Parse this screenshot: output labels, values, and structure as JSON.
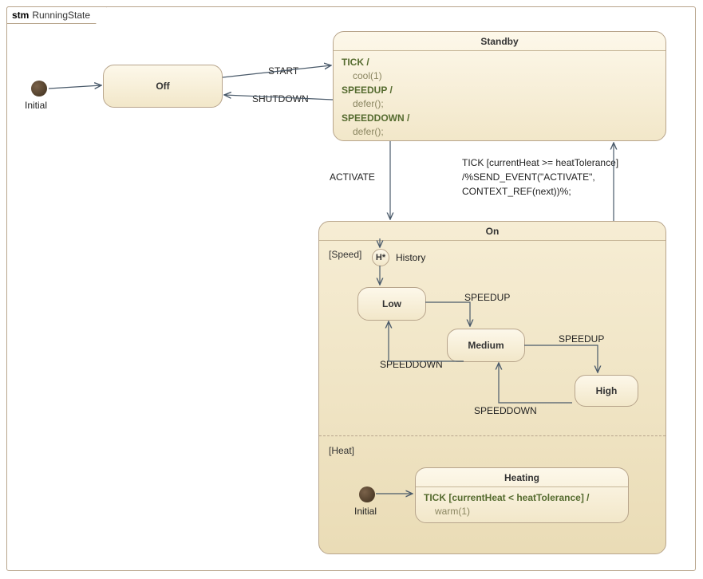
{
  "frame": {
    "keyword": "stm",
    "title": "RunningState"
  },
  "initialOuter": {
    "label": "Initial"
  },
  "states": {
    "off": {
      "name": "Off"
    },
    "standby": {
      "name": "Standby",
      "lines": [
        {
          "trigger": "TICK /",
          "action": "cool(1)"
        },
        {
          "trigger": "SPEEDUP /",
          "action": "defer();"
        },
        {
          "trigger": "SPEEDDOWN /",
          "action": "defer();"
        }
      ]
    },
    "on": {
      "name": "On",
      "regions": {
        "speed": {
          "label": "[Speed]",
          "historyLabel": "History",
          "historyGlyph": "H*"
        },
        "heat": {
          "label": "[Heat]",
          "initialLabel": "Initial",
          "heating": {
            "name": "Heating",
            "trigger": "TICK [currentHeat < heatTolerance] /",
            "action": "warm(1)"
          }
        }
      },
      "substates": {
        "low": {
          "name": "Low"
        },
        "medium": {
          "name": "Medium"
        },
        "high": {
          "name": "High"
        }
      }
    }
  },
  "transitions": {
    "start": "START",
    "shutdown": "SHUTDOWN",
    "activate": "ACTIVATE",
    "tickOverheat": "TICK [currentHeat >= heatTolerance]\n/%SEND_EVENT(\"ACTIVATE\",\nCONTEXT_REF(next))%;",
    "speedup1": "SPEEDUP",
    "speedup2": "SPEEDUP",
    "speeddown1": "SPEEDDOWN",
    "speeddown2": "SPEEDDOWN"
  },
  "chart_data": {
    "type": "state-machine",
    "name": "RunningState",
    "initial": "Off",
    "states": [
      {
        "id": "Off"
      },
      {
        "id": "Standby",
        "internal": [
          {
            "trigger": "TICK",
            "action": "cool(1)"
          },
          {
            "trigger": "SPEEDUP",
            "action": "defer();"
          },
          {
            "trigger": "SPEEDDOWN",
            "action": "defer();"
          }
        ]
      },
      {
        "id": "On",
        "regions": [
          {
            "id": "Speed",
            "history": "deep",
            "states": [
              "Low",
              "Medium",
              "High"
            ],
            "initialViaHistory": "Low",
            "transitions": [
              {
                "from": "Low",
                "to": "Medium",
                "trigger": "SPEEDUP"
              },
              {
                "from": "Medium",
                "to": "High",
                "trigger": "SPEEDUP"
              },
              {
                "from": "High",
                "to": "Medium",
                "trigger": "SPEEDDOWN"
              },
              {
                "from": "Medium",
                "to": "Low",
                "trigger": "SPEEDDOWN"
              }
            ]
          },
          {
            "id": "Heat",
            "initial": "Heating",
            "states": [
              {
                "id": "Heating",
                "internal": [
                  {
                    "trigger": "TICK",
                    "guard": "currentHeat < heatTolerance",
                    "action": "warm(1)"
                  }
                ]
              }
            ]
          }
        ]
      }
    ],
    "transitions": [
      {
        "from": "__initial__",
        "to": "Off"
      },
      {
        "from": "Off",
        "to": "Standby",
        "trigger": "START"
      },
      {
        "from": "Standby",
        "to": "Off",
        "trigger": "SHUTDOWN"
      },
      {
        "from": "Standby",
        "to": "On",
        "trigger": "ACTIVATE"
      },
      {
        "from": "On",
        "to": "Standby",
        "trigger": "TICK",
        "guard": "currentHeat >= heatTolerance",
        "action": "%SEND_EVENT(\"ACTIVATE\", CONTEXT_REF(next))%;"
      }
    ]
  }
}
